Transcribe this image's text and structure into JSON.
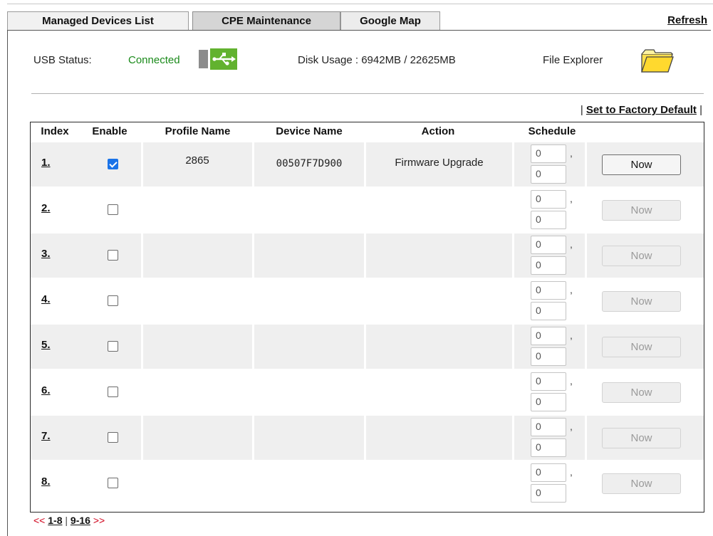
{
  "tabs": [
    {
      "label": "Managed Devices List"
    },
    {
      "label": "CPE Maintenance"
    },
    {
      "label": "Google Map"
    }
  ],
  "refresh_label": "Refresh",
  "usb": {
    "label": "USB Status:",
    "status": "Connected",
    "disk_usage": "Disk Usage : 6942MB / 22625MB",
    "file_explorer": "File Explorer"
  },
  "factory_default_label": "Set to Factory Default",
  "table": {
    "headers": [
      "Index",
      "Enable",
      "Profile Name",
      "Device Name",
      "Action",
      "Schedule"
    ],
    "rows": [
      {
        "index": "1.",
        "enabled": true,
        "profile": "2865",
        "device": "00507F7D900",
        "action": "Firmware Upgrade",
        "sched_a": "0",
        "sched_b": "0",
        "now_label": "Now",
        "now_enabled": true
      },
      {
        "index": "2.",
        "enabled": false,
        "profile": "",
        "device": "",
        "action": "",
        "sched_a": "0",
        "sched_b": "0",
        "now_label": "Now",
        "now_enabled": false
      },
      {
        "index": "3.",
        "enabled": false,
        "profile": "",
        "device": "",
        "action": "",
        "sched_a": "0",
        "sched_b": "0",
        "now_label": "Now",
        "now_enabled": false
      },
      {
        "index": "4.",
        "enabled": false,
        "profile": "",
        "device": "",
        "action": "",
        "sched_a": "0",
        "sched_b": "0",
        "now_label": "Now",
        "now_enabled": false
      },
      {
        "index": "5.",
        "enabled": false,
        "profile": "",
        "device": "",
        "action": "",
        "sched_a": "0",
        "sched_b": "0",
        "now_label": "Now",
        "now_enabled": false
      },
      {
        "index": "6.",
        "enabled": false,
        "profile": "",
        "device": "",
        "action": "",
        "sched_a": "0",
        "sched_b": "0",
        "now_label": "Now",
        "now_enabled": false
      },
      {
        "index": "7.",
        "enabled": false,
        "profile": "",
        "device": "",
        "action": "",
        "sched_a": "0",
        "sched_b": "0",
        "now_label": "Now",
        "now_enabled": false
      },
      {
        "index": "8.",
        "enabled": false,
        "profile": "",
        "device": "",
        "action": "",
        "sched_a": "0",
        "sched_b": "0",
        "now_label": "Now",
        "now_enabled": false
      }
    ]
  },
  "pager": {
    "prev": "<<",
    "page1": "1-8",
    "page2": "9-16",
    "next": ">>"
  },
  "colors": {
    "connected_green": "#1a8a1a",
    "usb_icon_green": "#62b22f",
    "checkbox_blue": "#1a73e8",
    "folder_yellow": "#ffe04d",
    "pager_arrow_red": "#d0021b"
  },
  "icons": {
    "usb": "usb-plug-icon",
    "folder": "folder-icon",
    "checkbox": "checkbox"
  }
}
